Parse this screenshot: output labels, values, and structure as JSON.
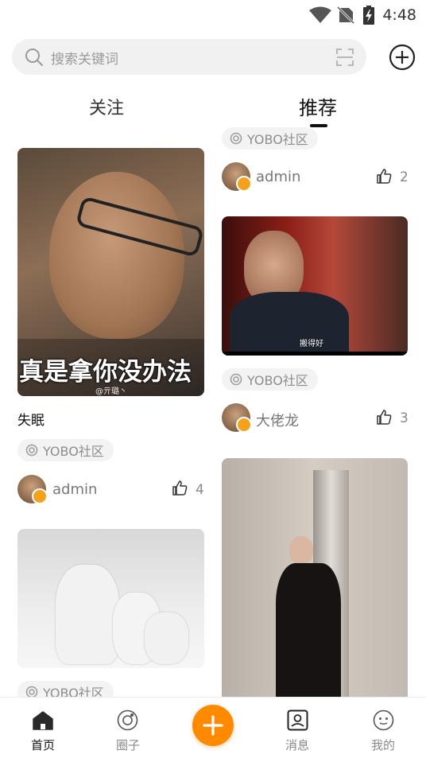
{
  "status_bar": {
    "time": "4:48"
  },
  "search": {
    "placeholder": "搜索关键词"
  },
  "tabs": [
    {
      "label": "关注",
      "active": false
    },
    {
      "label": "推荐",
      "active": true
    }
  ],
  "tag_icon": "circle-target-icon",
  "feed": {
    "left": [
      {
        "image_caption": "真是拿你没办法",
        "image_watermark": "@亓璐丶",
        "title": "失眠",
        "tag": "YOBO社区",
        "author": "admin",
        "likes": "4"
      },
      {
        "tag": "YOBO社区"
      }
    ],
    "right": [
      {
        "tag": "YOBO社区",
        "author": "admin",
        "likes": "2"
      },
      {
        "image_caption": "搬得好",
        "tag": "YOBO社区",
        "author": "大佬龙",
        "likes": "3"
      }
    ]
  },
  "bottom_nav": [
    {
      "label": "首页",
      "icon": "home-icon",
      "active": true
    },
    {
      "label": "圈子",
      "icon": "circle-icon",
      "active": false
    },
    {
      "label": "",
      "icon": "plus-icon",
      "active": false
    },
    {
      "label": "消息",
      "icon": "message-icon",
      "active": false
    },
    {
      "label": "我的",
      "icon": "profile-icon",
      "active": false
    }
  ],
  "colors": {
    "accent": "#ff8a00",
    "badge": "#f4a21b",
    "tag_bg": "#f3f3f3"
  }
}
